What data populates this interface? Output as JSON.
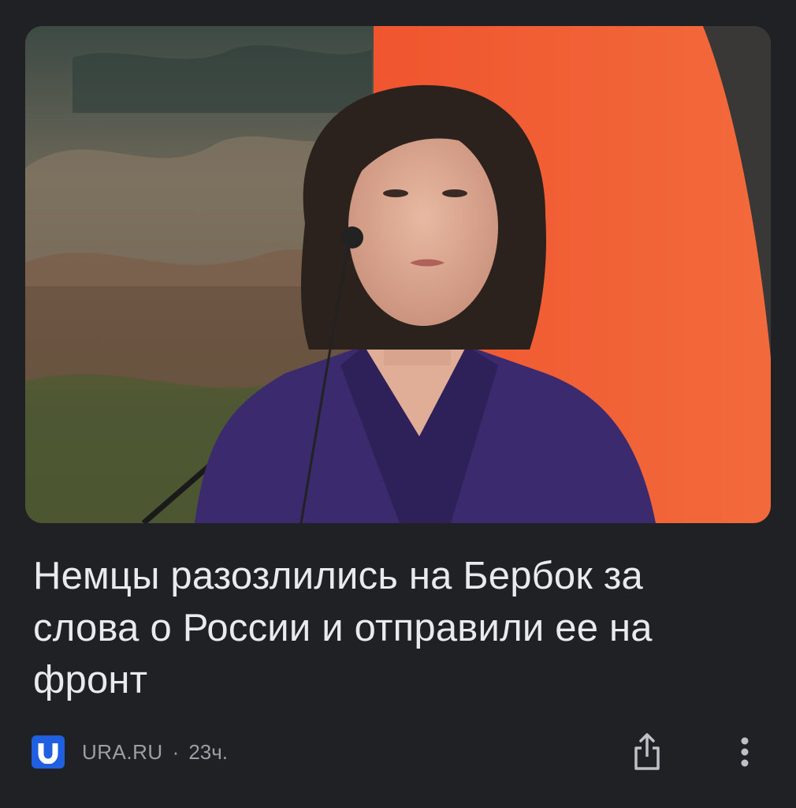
{
  "article": {
    "image_alt": "Photo of a woman in a purple jacket in front of an orange flag",
    "headline": "Немцы разозлились на Бербок за слова о России и отправили ее на фронт",
    "source_name": "URA.RU",
    "separator": "·",
    "time_ago": "23ч."
  },
  "icons": {
    "source_logo": "ura-logo-icon",
    "share": "share-icon",
    "more": "more-vert-icon"
  },
  "colors": {
    "background": "#202124",
    "headline_text": "#e8eaed",
    "meta_text": "#9aa0a6",
    "logo_blue": "#1f5fe0"
  }
}
